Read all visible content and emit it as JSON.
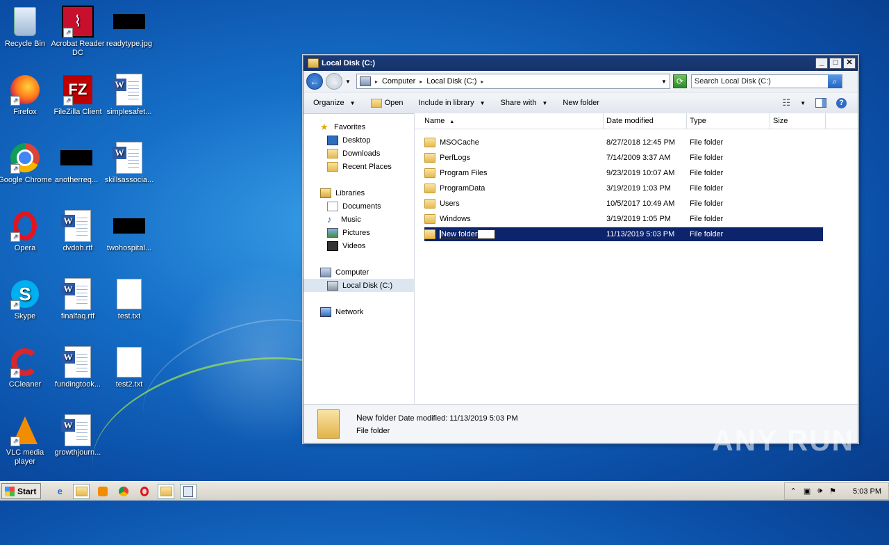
{
  "desktop": {
    "icons": [
      {
        "label": "Recycle Bin"
      },
      {
        "label": "Acrobat Reader DC"
      },
      {
        "label": "readytype.jpg"
      },
      {
        "label": "Firefox"
      },
      {
        "label": "FileZilla Client"
      },
      {
        "label": "simplesafet..."
      },
      {
        "label": "Google Chrome"
      },
      {
        "label": "anotherreq..."
      },
      {
        "label": "skillsassocia..."
      },
      {
        "label": "Opera"
      },
      {
        "label": "dvdoh.rtf"
      },
      {
        "label": "twohospital..."
      },
      {
        "label": "Skype"
      },
      {
        "label": "finalfaq.rtf"
      },
      {
        "label": "test.txt"
      },
      {
        "label": "CCleaner"
      },
      {
        "label": "fundingtook..."
      },
      {
        "label": "test2.txt"
      },
      {
        "label": "VLC media player"
      },
      {
        "label": "growthjourn..."
      }
    ]
  },
  "window": {
    "title": "Local Disk (C:)",
    "buttons": {
      "minimize": "_",
      "maximize": "□",
      "close": "✕"
    },
    "address": {
      "crumbs": [
        "Computer",
        "Local Disk (C:)"
      ]
    },
    "search_placeholder": "Search Local Disk (C:)",
    "toolbar": {
      "organize": "Organize",
      "open": "Open",
      "include": "Include in library",
      "share": "Share with",
      "new_folder": "New folder"
    },
    "nav": {
      "favorites": "Favorites",
      "desktop": "Desktop",
      "downloads": "Downloads",
      "recent": "Recent Places",
      "libraries": "Libraries",
      "documents": "Documents",
      "music": "Music",
      "pictures": "Pictures",
      "videos": "Videos",
      "computer": "Computer",
      "localdisk": "Local Disk (C:)",
      "network": "Network"
    },
    "columns": {
      "name": "Name",
      "date": "Date modified",
      "type": "Type",
      "size": "Size"
    },
    "files": [
      {
        "name": "MSOCache",
        "date": "8/27/2018 12:45 PM",
        "type": "File folder"
      },
      {
        "name": "PerfLogs",
        "date": "7/14/2009 3:37 AM",
        "type": "File folder"
      },
      {
        "name": "Program Files",
        "date": "9/23/2019 10:07 AM",
        "type": "File folder"
      },
      {
        "name": "ProgramData",
        "date": "3/19/2019 1:03 PM",
        "type": "File folder"
      },
      {
        "name": "Users",
        "date": "10/5/2017 10:49 AM",
        "type": "File folder"
      },
      {
        "name": "Windows",
        "date": "3/19/2019 1:05 PM",
        "type": "File folder"
      },
      {
        "name": "New folder",
        "date": "11/13/2019 5:03 PM",
        "type": "File folder"
      }
    ],
    "details": {
      "name": "New folder",
      "date_label": "Date modified:",
      "date": "11/13/2019 5:03 PM",
      "type": "File folder"
    }
  },
  "taskbar": {
    "start": "Start",
    "clock": "5:03 PM"
  },
  "watermark": "ANY RUN"
}
